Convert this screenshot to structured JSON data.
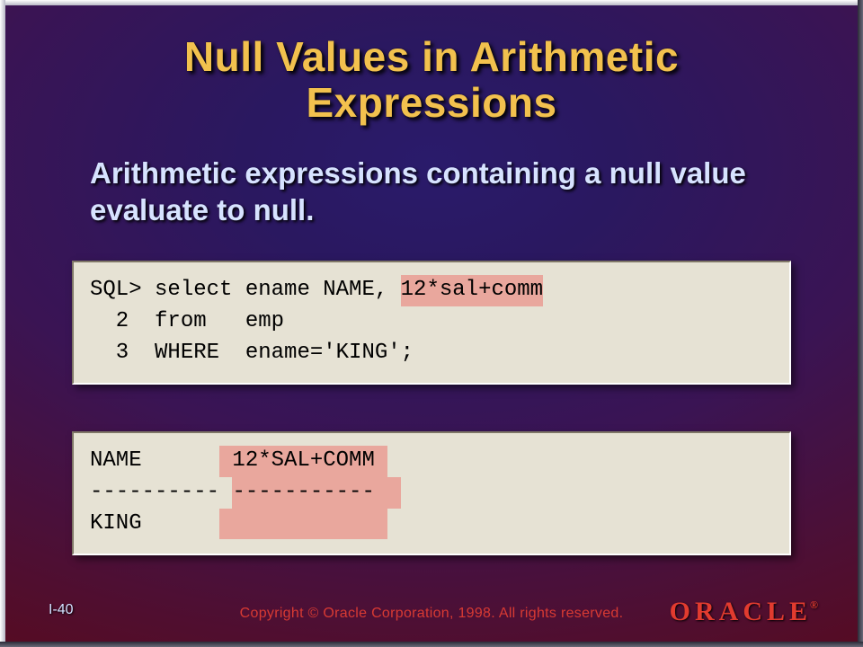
{
  "title": "Null Values in Arithmetic Expressions",
  "subtitle": "Arithmetic expressions containing a null value evaluate to null.",
  "code_block_1": {
    "line1_prefix": "SQL> select ename NAME, ",
    "line1_highlight": "12*sal+comm",
    "line2": "  2  from   emp",
    "line3": "  3  WHERE  ename='KING';"
  },
  "code_block_2": {
    "col1_header": "NAME      ",
    "col2_header": " 12*SAL+COMM ",
    "col1_sep": "---------- ",
    "col2_sep": "-----------  ",
    "col1_value": "KING      ",
    "col2_value": "             "
  },
  "page_number": "I-40",
  "copyright": "Copyright © Oracle Corporation, 1998. All rights reserved.",
  "logo_text": "ORACLE",
  "logo_mark": "®"
}
